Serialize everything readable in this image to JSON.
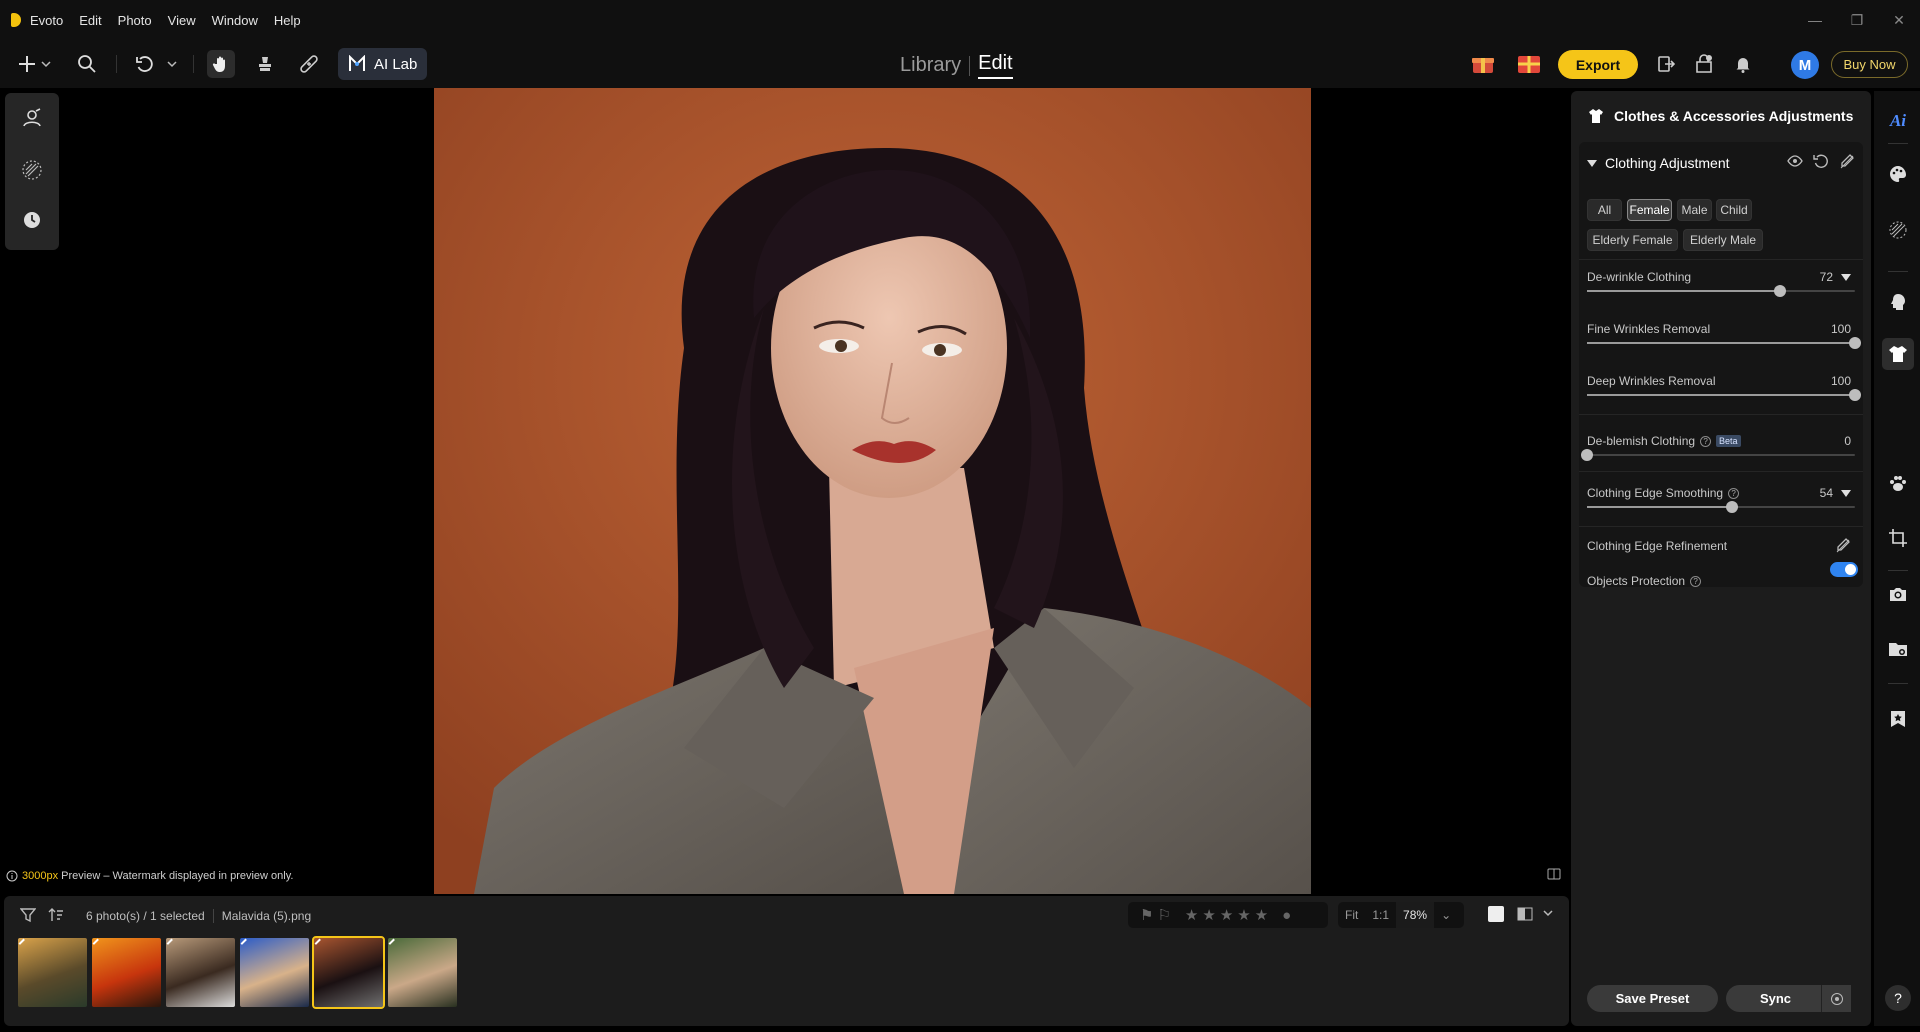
{
  "app": {
    "title": "Evoto"
  },
  "menu": [
    "Edit",
    "Photo",
    "View",
    "Window",
    "Help"
  ],
  "window_controls": {
    "minimize": "—",
    "restore": "❐",
    "close": "✕"
  },
  "toolbar": {
    "ai_lab_label": "AI Lab",
    "library_tab": "Library",
    "edit_tab": "Edit",
    "export_label": "Export",
    "avatar_initial": "M",
    "buy_now_label": "Buy Now"
  },
  "canvas": {
    "preview_size": "3000px",
    "preview_note": "Preview – Watermark displayed in preview only."
  },
  "filmstrip": {
    "count_text": "6 photo(s) / 1 selected",
    "filename": "Malavida (5).png",
    "zoom_fit": "Fit",
    "zoom_1to1": "1:1",
    "zoom_value": "78%",
    "thumbnails": [
      {
        "name": "thumb-1",
        "colors": [
          "#d9a24a",
          "#5a4a2a",
          "#2a3a2a"
        ]
      },
      {
        "name": "thumb-2",
        "colors": [
          "#f0941c",
          "#c7350d",
          "#2a160c"
        ]
      },
      {
        "name": "thumb-3",
        "colors": [
          "#b89a7a",
          "#3a2a20",
          "#dcdcdc"
        ]
      },
      {
        "name": "thumb-4",
        "colors": [
          "#2b5cc8",
          "#d8b28a",
          "#1a2a4a"
        ]
      },
      {
        "name": "thumb-5",
        "colors": [
          "#a85530",
          "#1a1012",
          "#707070"
        ]
      },
      {
        "name": "thumb-6",
        "colors": [
          "#4a6a3a",
          "#caa888",
          "#283020"
        ]
      }
    ],
    "selected_index": 4
  },
  "panel": {
    "title": "Clothes & Accessories Adjustments",
    "section_title": "Clothing Adjustment",
    "chips": [
      "All",
      "Female",
      "Male",
      "Child",
      "Elderly Female",
      "Elderly Male"
    ],
    "active_chip": "Female",
    "sliders": [
      {
        "label": "De-wrinkle Clothing",
        "value": 72,
        "expandable": true
      },
      {
        "label": "Fine Wrinkles Removal",
        "value": 100
      },
      {
        "label": "Deep Wrinkles Removal",
        "value": 100
      },
      {
        "label": "De-blemish Clothing",
        "value": 0,
        "badge": "Beta",
        "help": true
      },
      {
        "label": "Clothing Edge Smoothing",
        "value": 54,
        "expandable": true,
        "help": true
      }
    ],
    "edge_refinement_label": "Clothing Edge Refinement",
    "objects_protection_label": "Objects Protection",
    "objects_protection_on": true,
    "save_preset_label": "Save Preset",
    "sync_label": "Sync"
  },
  "rail": {
    "ai_label": "Ai",
    "help_label": "?"
  },
  "colors": {
    "accent": "#f5c518",
    "toggle_on": "#2f84f0",
    "photo_bg": "#b45a2c",
    "jacket": "#6e6760",
    "hair": "#1a0f14",
    "skin": "#e3b9a2",
    "lips": "#a8322c"
  }
}
